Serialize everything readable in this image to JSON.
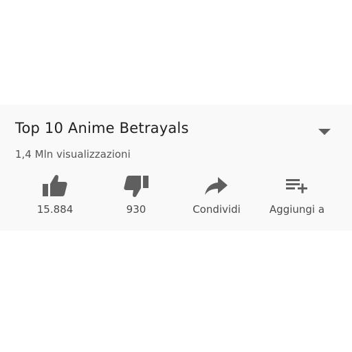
{
  "video": {
    "title": "Top 10 Anime Betrayals",
    "views": "1,4 Mln visualizzazioni"
  },
  "actions": {
    "like": {
      "label": "15.884",
      "icon": "thumbs-up-icon"
    },
    "dislike": {
      "label": "930",
      "icon": "thumbs-down-icon"
    },
    "share": {
      "label": "Condividi",
      "icon": "share-arrow-icon"
    },
    "add": {
      "label": "Aggiungi a",
      "icon": "playlist-add-icon"
    }
  },
  "colors": {
    "panel_background": "#f9f9f9",
    "icon": "#5f5f5f",
    "text": "#222222"
  }
}
